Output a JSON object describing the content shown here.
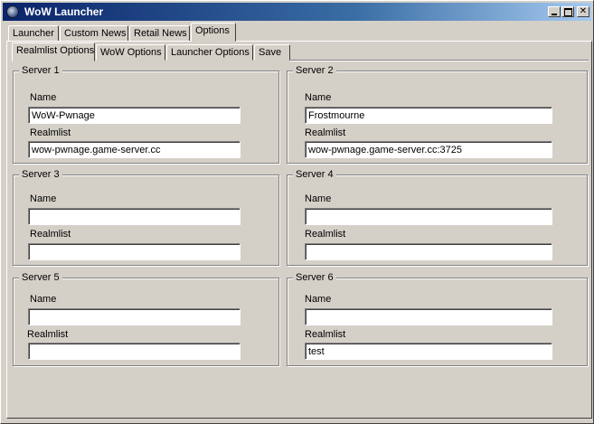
{
  "window": {
    "title": "WoW Launcher"
  },
  "main_tabs": [
    {
      "label": "Launcher"
    },
    {
      "label": "Custom News"
    },
    {
      "label": "Retail News"
    },
    {
      "label": "Options",
      "active": true
    }
  ],
  "sub_tabs": [
    {
      "label": "Realmlist Options",
      "active": true
    },
    {
      "label": "WoW Options"
    },
    {
      "label": "Launcher Options"
    },
    {
      "label": "Save"
    }
  ],
  "servers": [
    {
      "title": "Server 1",
      "name_label": "Name",
      "realmlist_label": "Realmlist",
      "name": "WoW-Pwnage",
      "realmlist": "wow-pwnage.game-server.cc"
    },
    {
      "title": "Server 2",
      "name_label": "Name",
      "realmlist_label": "Realmlist",
      "name": "Frostmourne",
      "realmlist": "wow-pwnage.game-server.cc:3725"
    },
    {
      "title": "Server 3",
      "name_label": "Name",
      "realmlist_label": "Realmlist",
      "name": "",
      "realmlist": ""
    },
    {
      "title": "Server 4",
      "name_label": "Name",
      "realmlist_label": "Realmlist",
      "name": "",
      "realmlist": ""
    },
    {
      "title": "Server 5",
      "name_label": "Name",
      "realmlist_label": "Realmlist",
      "name": "",
      "realmlist": ""
    },
    {
      "title": "Server 6",
      "name_label": "Name",
      "realmlist_label": "Realmlist",
      "name": "",
      "realmlist": "test"
    }
  ]
}
